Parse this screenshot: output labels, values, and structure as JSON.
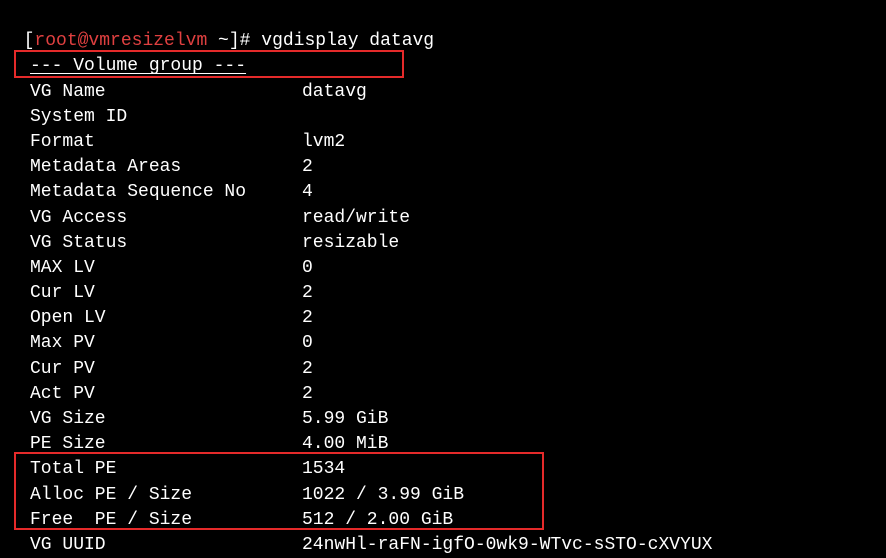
{
  "prompt": {
    "open_bracket": "[",
    "user_host": "root@vmresizelvm",
    "path": " ~",
    "close_bracket": "]",
    "symbol": "# ",
    "command": "vgdisplay datavg"
  },
  "divider": "--- Volume group ---",
  "rows": [
    {
      "label": "VG Name",
      "value": "datavg"
    },
    {
      "label": "System ID",
      "value": ""
    },
    {
      "label": "Format",
      "value": "lvm2"
    },
    {
      "label": "Metadata Areas",
      "value": "2"
    },
    {
      "label": "Metadata Sequence No",
      "value": "4"
    },
    {
      "label": "VG Access",
      "value": "read/write"
    },
    {
      "label": "VG Status",
      "value": "resizable"
    },
    {
      "label": "MAX LV",
      "value": "0"
    },
    {
      "label": "Cur LV",
      "value": "2"
    },
    {
      "label": "Open LV",
      "value": "2"
    },
    {
      "label": "Max PV",
      "value": "0"
    },
    {
      "label": "Cur PV",
      "value": "2"
    },
    {
      "label": "Act PV",
      "value": "2"
    },
    {
      "label": "VG Size",
      "value": "5.99 GiB"
    },
    {
      "label": "PE Size",
      "value": "4.00 MiB"
    },
    {
      "label": "Total PE",
      "value": "1534"
    },
    {
      "label": "Alloc PE / Size",
      "value": "1022 / 3.99 GiB"
    },
    {
      "label": "Free  PE / Size",
      "value": "512 / 2.00 GiB"
    },
    {
      "label": "VG UUID",
      "value": "24nwHl-raFN-igfO-0wk9-WTvc-sSTO-cXVYUX"
    }
  ]
}
